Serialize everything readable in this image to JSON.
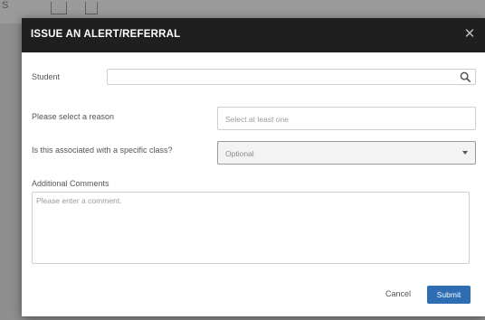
{
  "background": {
    "fragment_text": "S"
  },
  "modal": {
    "title": "ISSUE AN ALERT/REFERRAL",
    "close_icon": "close-icon",
    "student": {
      "label": "Student",
      "value": "",
      "search_icon": "search-icon"
    },
    "reason": {
      "label": "Please select a reason",
      "placeholder": "Select at least one"
    },
    "class_select": {
      "label": "Is this associated with a specific class?",
      "selected": "Optional"
    },
    "comments": {
      "label": "Additional Comments",
      "placeholder": "Please enter a comment."
    },
    "buttons": {
      "cancel": "Cancel",
      "submit": "Submit"
    },
    "colors": {
      "header_bg": "#1f1f1f",
      "submit_bg": "#2e6db4"
    }
  }
}
